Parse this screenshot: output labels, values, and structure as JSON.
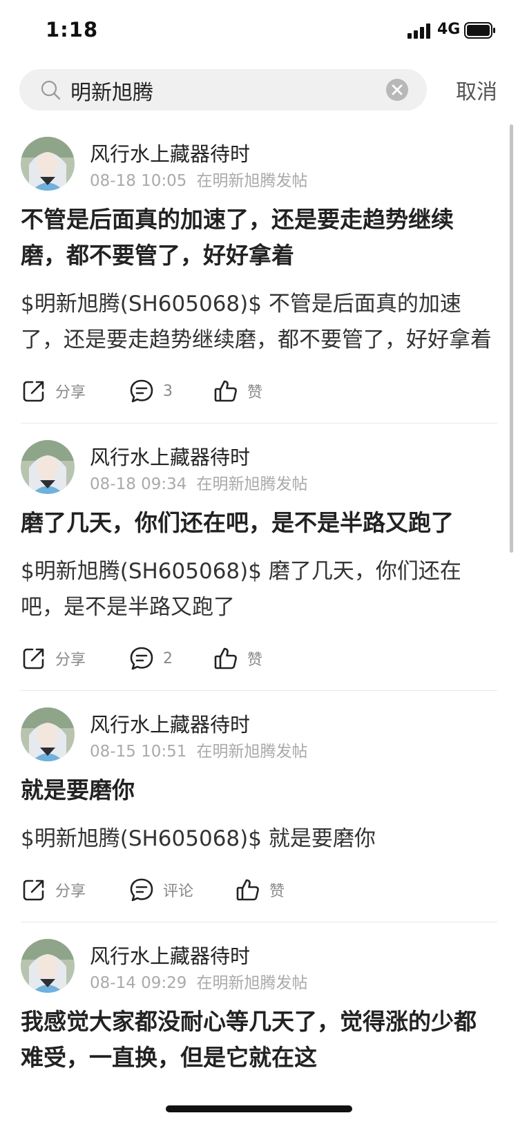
{
  "status": {
    "time": "1:18",
    "network": "4G"
  },
  "search": {
    "query": "明新旭腾",
    "cancel_label": "取消"
  },
  "posts": [
    {
      "author": "风行水上藏器待时",
      "time": "08-18 10:05",
      "venue": "在明新旭腾发帖",
      "title": "不管是后面真的加速了，还是要走趋势继续磨，都不要管了，好好拿着",
      "body": "$明新旭腾(SH605068)$ 不管是后面真的加速了，还是要走趋势继续磨，都不要管了，好好拿着",
      "share_label": "分享",
      "comment_label": "3",
      "like_label": "赞"
    },
    {
      "author": "风行水上藏器待时",
      "time": "08-18 09:34",
      "venue": "在明新旭腾发帖",
      "title": "磨了几天，你们还在吧，是不是半路又跑了",
      "body": "$明新旭腾(SH605068)$ 磨了几天，你们还在吧，是不是半路又跑了",
      "share_label": "分享",
      "comment_label": "2",
      "like_label": "赞"
    },
    {
      "author": "风行水上藏器待时",
      "time": "08-15 10:51",
      "venue": "在明新旭腾发帖",
      "title": "就是要磨你",
      "body": "$明新旭腾(SH605068)$ 就是要磨你",
      "share_label": "分享",
      "comment_label": "评论",
      "like_label": "赞"
    },
    {
      "author": "风行水上藏器待时",
      "time": "08-14 09:29",
      "venue": "在明新旭腾发帖",
      "title": "我感觉大家都没耐心等几天了，觉得涨的少都难受，一直换，但是它就在这"
    }
  ]
}
